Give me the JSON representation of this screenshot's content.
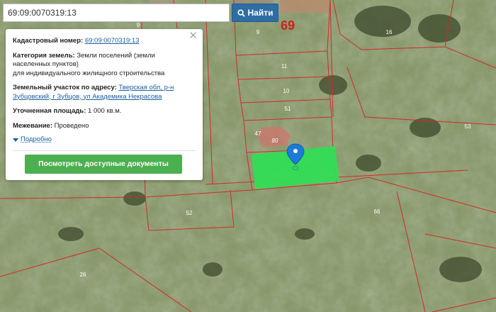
{
  "search": {
    "value": "69:09:0070319:13",
    "button_label": "Найти"
  },
  "panel": {
    "cadastral_label": "Кадастровый номер:",
    "cadastral_value": "69:09:0070319:13",
    "category_label": "Категория земель:",
    "category_value_1": "Земли поселений (земли",
    "category_value_2": "населенных пунктов)",
    "category_value_3": "для индивидуального жилищного строительства",
    "address_label": "Земельный участок по адресу:",
    "address_value_1": "Тверская обл, р-н",
    "address_value_2": "Зубцовский, г Зубцов, ул Академика Некрасова",
    "area_label": "Уточненная площадь:",
    "area_value": "1 000 кв.м.",
    "survey_label": "Межевание:",
    "survey_value": "Проведено",
    "more_label": "Подробно",
    "docs_button_label": "Посмотреть доступные документы"
  },
  "map": {
    "region_label": "69",
    "parcel_labels": {
      "p9": "9",
      "p16": "16",
      "p11": "11",
      "p10": "10",
      "p51": "51",
      "p47": "47",
      "p80": "80",
      "p53": "53",
      "p52": "52",
      "p66": "66",
      "p26": "26",
      "p9b": "9"
    },
    "colors": {
      "highlight": "#33dd55",
      "parcel_line": "#d22a2a",
      "marker": "#1e7ad8",
      "button_blue": "#2e6da4",
      "docs_button": "#4caf50"
    }
  }
}
